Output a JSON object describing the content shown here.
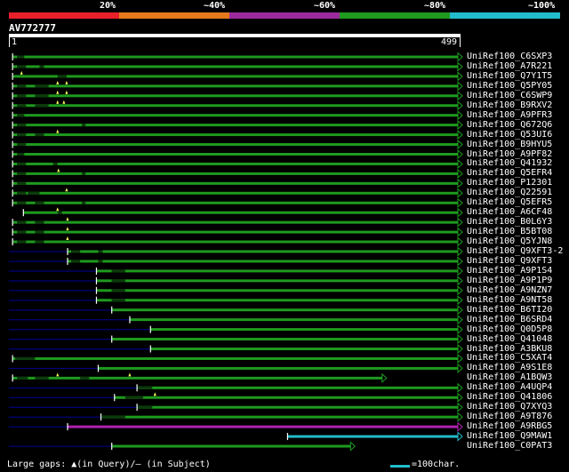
{
  "legend": {
    "labels": [
      "20%",
      "~40%",
      "~60%",
      "~80%",
      "~100%"
    ],
    "colors": [
      "#e8202a",
      "#e5791c",
      "#9c2a9c",
      "#1f9a1f",
      "#22bccc"
    ]
  },
  "query": {
    "id": "AV772777",
    "start": "1",
    "end": "499",
    "length": 499
  },
  "colors": {
    "green": "#1e9a1e",
    "navy": "#000080",
    "magenta": "#b020b0",
    "cyan": "#22bccc",
    "marker": "#ffff66"
  },
  "hits": [
    {
      "label": "UniRef100_C6SXP3",
      "color": "green",
      "start": 5,
      "end": 499,
      "dark": [
        [
          10,
          18
        ]
      ],
      "gaps": []
    },
    {
      "label": "UniRef100_A7R221",
      "color": "green",
      "start": 5,
      "end": 499,
      "dark": [
        [
          10,
          20
        ],
        [
          35,
          40
        ]
      ],
      "gaps": []
    },
    {
      "label": "UniRef100_Q7Y1T5",
      "color": "green",
      "start": 5,
      "end": 499,
      "dark": [
        [
          55,
          65
        ]
      ],
      "gaps": [
        15
      ]
    },
    {
      "label": "UniRef100_Q5PY05",
      "color": "green",
      "start": 5,
      "end": 499,
      "dark": [
        [
          10,
          20
        ],
        [
          30,
          45
        ]
      ],
      "gaps": [
        55,
        65
      ]
    },
    {
      "label": "UniRef100_C6SWP9",
      "color": "green",
      "start": 5,
      "end": 499,
      "dark": [
        [
          10,
          20
        ],
        [
          30,
          45
        ]
      ],
      "gaps": [
        55,
        65
      ]
    },
    {
      "label": "UniRef100_B9RXV2",
      "color": "green",
      "start": 5,
      "end": 499,
      "dark": [
        [
          10,
          20
        ],
        [
          30,
          45
        ]
      ],
      "gaps": [
        55,
        62
      ]
    },
    {
      "label": "UniRef100_A9PFR3",
      "color": "green",
      "start": 5,
      "end": 499,
      "dark": [
        [
          10,
          18
        ]
      ],
      "gaps": []
    },
    {
      "label": "UniRef100_Q672Q6",
      "color": "green",
      "start": 5,
      "end": 499,
      "dark": [
        [
          10,
          20
        ],
        [
          82,
          86
        ]
      ],
      "gaps": []
    },
    {
      "label": "UniRef100_Q53UI6",
      "color": "green",
      "start": 5,
      "end": 499,
      "dark": [
        [
          10,
          20
        ],
        [
          30,
          40
        ]
      ],
      "gaps": [
        55
      ]
    },
    {
      "label": "UniRef100_B9HYU5",
      "color": "green",
      "start": 5,
      "end": 499,
      "dark": [
        [
          10,
          20
        ]
      ],
      "gaps": []
    },
    {
      "label": "UniRef100_A9PF82",
      "color": "green",
      "start": 5,
      "end": 499,
      "dark": [
        [
          10,
          18
        ]
      ],
      "gaps": []
    },
    {
      "label": "UniRef100_Q41932",
      "color": "green",
      "start": 5,
      "end": 499,
      "dark": [
        [
          10,
          20
        ],
        [
          50,
          55
        ]
      ],
      "gaps": []
    },
    {
      "label": "UniRef100_Q5EFR4",
      "color": "green",
      "start": 5,
      "end": 499,
      "dark": [
        [
          10,
          20
        ],
        [
          82,
          86
        ]
      ],
      "gaps": [
        56
      ]
    },
    {
      "label": "UniRef100_P12301",
      "color": "green",
      "start": 5,
      "end": 499,
      "dark": [
        [
          10,
          20
        ]
      ],
      "gaps": []
    },
    {
      "label": "UniRef100_Q22591",
      "color": "green",
      "start": 5,
      "end": 499,
      "dark": [
        [
          10,
          20
        ],
        [
          22,
          35
        ]
      ],
      "gaps": [
        65
      ]
    },
    {
      "label": "UniRef100_Q5EFR5",
      "color": "green",
      "start": 5,
      "end": 499,
      "dark": [
        [
          10,
          20
        ],
        [
          30,
          40
        ],
        [
          82,
          86
        ]
      ],
      "gaps": []
    },
    {
      "label": "UniRef100_A6CF48",
      "color": "green",
      "start": 17,
      "end": 499,
      "dark": [
        [
          55,
          60
        ]
      ],
      "gaps": [
        55
      ]
    },
    {
      "label": "UniRef100_B0L6Y3",
      "color": "green",
      "start": 5,
      "end": 499,
      "dark": [
        [
          10,
          20
        ],
        [
          30,
          40
        ]
      ],
      "gaps": [
        66
      ]
    },
    {
      "label": "UniRef100_B5BT08",
      "color": "green",
      "start": 5,
      "end": 499,
      "dark": [
        [
          10,
          20
        ],
        [
          30,
          40
        ]
      ],
      "gaps": [
        66
      ]
    },
    {
      "label": "UniRef100_Q5YJN8",
      "color": "green",
      "start": 5,
      "end": 499,
      "dark": [
        [
          10,
          20
        ],
        [
          30,
          40
        ]
      ],
      "gaps": [
        66
      ]
    },
    {
      "label": "UniRef100_Q9XFT3-2",
      "color": "green",
      "start": 66,
      "end": 499,
      "navy": [
        [
          1,
          66
        ]
      ],
      "dark": [
        [
          70,
          80
        ],
        [
          100,
          105
        ]
      ],
      "gaps": []
    },
    {
      "label": "UniRef100_Q9XFT3",
      "color": "green",
      "start": 66,
      "end": 499,
      "navy": [
        [
          1,
          66
        ]
      ],
      "dark": [
        [
          70,
          80
        ],
        [
          100,
          105
        ]
      ],
      "gaps": []
    },
    {
      "label": "UniRef100_A9P1S4",
      "color": "green",
      "start": 98,
      "end": 499,
      "navy": [
        [
          1,
          98
        ]
      ],
      "dark": [
        [
          115,
          130
        ]
      ],
      "gaps": []
    },
    {
      "label": "UniRef100_A9P1P9",
      "color": "green",
      "start": 98,
      "end": 499,
      "navy": [
        [
          1,
          98
        ]
      ],
      "dark": [
        [
          115,
          130
        ]
      ],
      "gaps": []
    },
    {
      "label": "UniRef100_A9NZN7",
      "color": "green",
      "start": 98,
      "end": 499,
      "navy": [
        [
          1,
          98
        ]
      ],
      "dark": [
        [
          115,
          130
        ]
      ],
      "gaps": []
    },
    {
      "label": "UniRef100_A9NT58",
      "color": "green",
      "start": 98,
      "end": 499,
      "navy": [
        [
          1,
          98
        ]
      ],
      "dark": [
        [
          115,
          130
        ]
      ],
      "gaps": []
    },
    {
      "label": "UniRef100_B6TI20",
      "color": "green",
      "start": 115,
      "end": 499,
      "navy": [
        [
          1,
          115
        ]
      ],
      "dark": [],
      "gaps": []
    },
    {
      "label": "UniRef100_B6SRD4",
      "color": "green",
      "start": 135,
      "end": 499,
      "navy": [
        [
          1,
          135
        ]
      ],
      "dark": [],
      "gaps": []
    },
    {
      "label": "UniRef100_Q0D5P8",
      "color": "green",
      "start": 158,
      "end": 499,
      "navy": [
        [
          1,
          158
        ]
      ],
      "dark": [],
      "gaps": []
    },
    {
      "label": "UniRef100_Q41048",
      "color": "green",
      "start": 115,
      "end": 499,
      "navy": [
        [
          1,
          115
        ]
      ],
      "dark": [],
      "gaps": []
    },
    {
      "label": "UniRef100_A3BKU8",
      "color": "green",
      "start": 158,
      "end": 499,
      "navy": [
        [
          1,
          158
        ]
      ],
      "dark": [],
      "gaps": []
    },
    {
      "label": "UniRef100_C5XAT4",
      "color": "green",
      "start": 5,
      "end": 499,
      "dark": [
        [
          8,
          30
        ]
      ],
      "gaps": []
    },
    {
      "label": "UniRef100_A9S1E8",
      "color": "green",
      "start": 100,
      "end": 499,
      "navy": [
        [
          1,
          100
        ]
      ],
      "dark": [],
      "gaps": []
    },
    {
      "label": "UniRef100_A1BQW3",
      "color": "green",
      "start": 5,
      "end": 415,
      "dark": [
        [
          10,
          22
        ],
        [
          30,
          45
        ],
        [
          80,
          90
        ]
      ],
      "gaps": [
        55,
        135
      ]
    },
    {
      "label": "UniRef100_A4UQP4",
      "color": "green",
      "start": 143,
      "end": 499,
      "navy": [
        [
          1,
          143
        ]
      ],
      "dark": [
        [
          143,
          160
        ]
      ],
      "gaps": []
    },
    {
      "label": "UniRef100_Q41806",
      "color": "green",
      "start": 118,
      "end": 499,
      "navy": [
        [
          1,
          118
        ]
      ],
      "dark": [
        [
          130,
          150
        ]
      ],
      "gaps": [
        163
      ]
    },
    {
      "label": "UniRef100_Q7XYQ3",
      "color": "green",
      "start": 143,
      "end": 499,
      "navy": [
        [
          1,
          143
        ]
      ],
      "dark": [
        [
          143,
          160
        ]
      ],
      "gaps": []
    },
    {
      "label": "UniRef100_A9T876",
      "color": "green",
      "start": 103,
      "end": 499,
      "navy": [
        [
          1,
          103
        ]
      ],
      "dark": [
        [
          103,
          130
        ]
      ],
      "gaps": []
    },
    {
      "label": "UniRef100_A9RBG5",
      "color": "magenta",
      "start": 66,
      "end": 499,
      "navy": [
        [
          1,
          66
        ]
      ],
      "dark": [],
      "gaps": []
    },
    {
      "label": "UniRef100_Q9MAW1",
      "color": "cyan",
      "start": 310,
      "end": 499,
      "navy": [],
      "dark": [],
      "gaps": []
    },
    {
      "label": "UniRef100_C0PAT3",
      "color": "green",
      "start": 115,
      "end": 380,
      "navy": [
        [
          1,
          115
        ]
      ],
      "dark": [],
      "gaps": []
    }
  ],
  "footer": {
    "note": "Large gaps: ▲(in Query)/– (in Subject)",
    "scale_label": "=100char."
  }
}
